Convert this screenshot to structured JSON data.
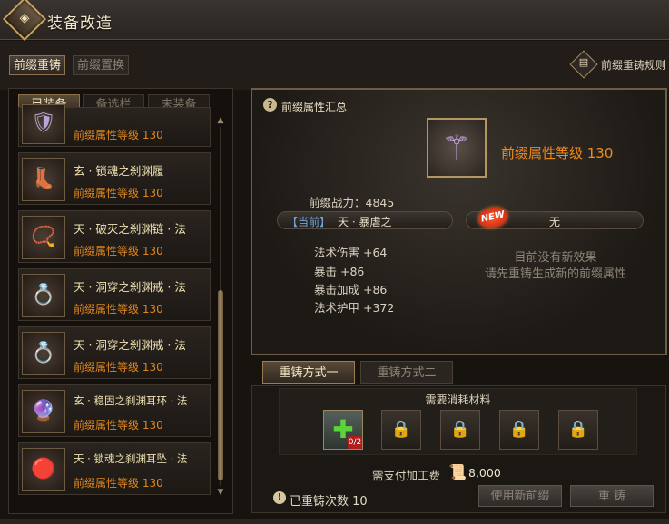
{
  "window": {
    "title": "装备改造",
    "logo_icon": "diamond-emblem"
  },
  "top_tabs": [
    {
      "label": "前缀重铸",
      "active": true
    },
    {
      "label": "前缀置换",
      "active": false
    }
  ],
  "rules_button": {
    "label": "前缀重铸规则",
    "icon": "document-icon"
  },
  "sub_tabs": [
    {
      "label": "已装备",
      "active": true
    },
    {
      "label": "备选栏",
      "active": false
    },
    {
      "label": "未装备",
      "active": false
    }
  ],
  "items": [
    {
      "name": "",
      "level": "前缀属性等级 130",
      "icon": "armor-icon",
      "glyph": "🛡",
      "color": "#b9a6d8"
    },
    {
      "name": "玄 · 锁魂之刹渊履",
      "level": "前缀属性等级 130",
      "icon": "boots-icon",
      "glyph": "👢",
      "color": "#b39ad6"
    },
    {
      "name": "天 · 破灭之刹渊链 · 法",
      "level": "前缀属性等级 130",
      "icon": "necklace-icon",
      "glyph": "📿",
      "color": "#d1a0d8"
    },
    {
      "name": "天 · 洞穿之刹渊戒 · 法",
      "level": "前缀属性等级 130",
      "icon": "ring-icon",
      "glyph": "💍",
      "color": "#dcc8e8"
    },
    {
      "name": "天 · 洞穿之刹渊戒 · 法",
      "level": "前缀属性等级 130",
      "icon": "ring-icon",
      "glyph": "💍",
      "color": "#dcc8e8"
    },
    {
      "name": "玄 · 稳固之刹渊耳环 · 法",
      "level": "前缀属性等级 130",
      "icon": "earring-icon",
      "glyph": "🔮",
      "color": "#a77be0"
    },
    {
      "name": "天 · 锁魂之刹渊耳坠 · 法",
      "level": "前缀属性等级 130",
      "icon": "earring-icon",
      "glyph": "🔴",
      "color": "#d0523a"
    }
  ],
  "summary": {
    "title": "前缀属性汇总",
    "help_icon": "?",
    "prefix_level": "前缀属性等级 130",
    "power": "前缀战力：4845",
    "current_tag": "【当前】",
    "current_prefix": "天 · 暴虐之",
    "new_badge": "NEW",
    "new_prefix": "无",
    "stats": [
      "法术伤害 +64",
      "暴击 +86",
      "暴击加成 +86",
      "法术护甲 +372"
    ],
    "no_effect_line1": "目前没有新效果",
    "no_effect_line2": "请先重铸生成新的前缀属性"
  },
  "method_tabs": [
    {
      "label": "重铸方式一",
      "active": true
    },
    {
      "label": "重铸方式二",
      "active": false
    }
  ],
  "materials": {
    "title": "需要消耗材料",
    "first_slot_badge": "0/2",
    "fee_label": "需支付加工费",
    "fee_value": "8,000",
    "reforge_count": "已重铸次数 10",
    "info_icon": "!"
  },
  "buttons": {
    "use_new": "使用新前缀",
    "reforge": "重 铸"
  },
  "colors": {
    "accent_orange": "#ef8b1e",
    "gold": "#c9a35e",
    "current_blue": "#6fa4d8",
    "green_plus": "#5bd43a"
  }
}
